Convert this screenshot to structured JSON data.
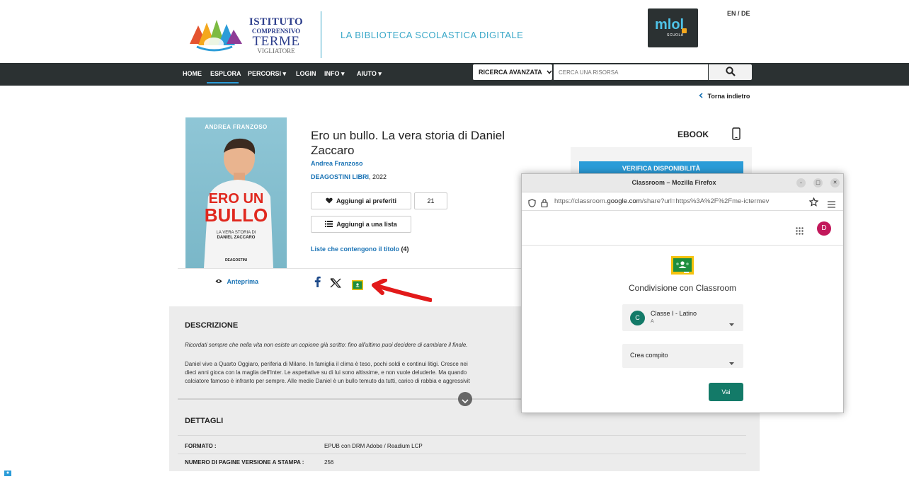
{
  "header": {
    "school_line1": "ISTITUTO",
    "school_line2": "COMPRENSIVO",
    "school_line3": "TERME",
    "school_line4": "VIGLIATORE",
    "tagline": "LA BIBLIOTECA SCOLASTICA DIGITALE",
    "mlol_logo_text": "mlol",
    "mlol_logo_sub": "SCUOLA",
    "lang": "EN / DE"
  },
  "nav": {
    "items": [
      "HOME",
      "ESPLORA",
      "PERCORSI ▾",
      "LOGIN",
      "INFO ▾",
      "AIUTO ▾"
    ],
    "active": "ESPLORA",
    "advanced_search": "RICERCA AVANZATA",
    "search_placeholder": "CERCA UNA RISORSA"
  },
  "back": "Torna indietro",
  "book": {
    "cover_author": "ANDREA FRANZOSO",
    "cover_title_1": "ERO UN",
    "cover_title_2": "BULLO",
    "cover_sub1": "LA VERA STORIA DI",
    "cover_sub2": "DANIEL ZACCARO",
    "cover_publisher": "DEAGOSTINI",
    "title": "Ero un bullo. La vera storia di Daniel Zaccaro",
    "author": "Andrea Franzoso",
    "publisher": "DEAGOSTINI LIBRI",
    "year": ", 2022",
    "favorites_label": "Aggiungi ai preferiti",
    "favorites_count": "21",
    "add_list_label": "Aggiungi a una lista",
    "lists_link": "Liste che contengono il titolo",
    "lists_count": "(4)",
    "format_label": "EBOOK",
    "verify": "VERIFICA DISPONIBILITÀ",
    "preview": "Anteprima"
  },
  "description": {
    "heading": "DESCRIZIONE",
    "italic": "Ricordati sempre che nella vita non esiste un copione già scritto: fino all'ultimo puoi decidere di cambiare il finale.",
    "line1": "Daniel vive a Quarto Oggiaro, periferia di Milano. In famiglia il clima è teso, pochi soldi e continui litigi. Cresce nei",
    "line2": "dieci anni gioca con la maglia dell'Inter. Le aspettative su di lui sono altissime, e non vuole deluderle. Ma quando",
    "line3": "calciatore famoso è infranto per sempre. Alle medie Daniel è un bullo temuto da tutti, carico di rabbia e aggressivit"
  },
  "details": {
    "heading": "DETTAGLI",
    "rows": [
      {
        "label": "FORMATO :",
        "value": "EPUB con DRM Adobe / Readium LCP"
      },
      {
        "label": "NUMERO DI PAGINE VERSIONE A STAMPA :",
        "value": "256"
      }
    ]
  },
  "popup": {
    "window_title": "Classroom – Mozilla Firefox",
    "url_prefix": "https://classroom.",
    "url_domain": "google.com",
    "url_rest": "/share?url=https%3A%2F%2Fme-ictermev",
    "avatar": "D",
    "share_title": "Condivisione con Classroom",
    "class_initial": "C",
    "class_name": "Classe I - Latino",
    "class_section": "A",
    "action": "Crea compito",
    "submit": "Vai"
  },
  "colors": {
    "nav_bg": "#2b3132",
    "accent_blue": "#2b9cd8",
    "link_blue": "#1a73b5",
    "classroom_green": "#137a68",
    "avatar_pink": "#c2185b"
  }
}
